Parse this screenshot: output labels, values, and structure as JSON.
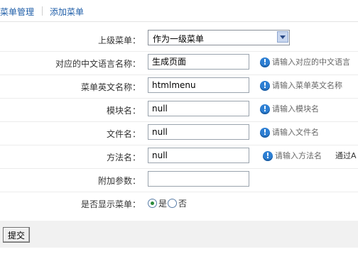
{
  "tabs": [
    {
      "label": "菜单管理"
    },
    {
      "label": "添加菜单"
    }
  ],
  "form": {
    "parent_menu": {
      "label": "上级菜单：",
      "selected": "作为一级菜单"
    },
    "cn_name": {
      "label": "对应的中文语言名称：",
      "value": "生成页面",
      "hint": "请输入对应的中文语言"
    },
    "en_name": {
      "label": "菜单英文名称：",
      "value": "htmlmenu",
      "hint": "请输入菜单英文名称"
    },
    "module": {
      "label": "模块名：",
      "value": "null",
      "hint": "请输入模块名"
    },
    "file": {
      "label": "文件名：",
      "value": "null",
      "hint": "请输入文件名"
    },
    "method": {
      "label": "方法名：",
      "value": "null",
      "hint": "请输入方法名",
      "extra": "通过A"
    },
    "params": {
      "label": "附加参数：",
      "value": ""
    },
    "show_menu": {
      "label": "是否显示菜单：",
      "options": [
        "是",
        "否"
      ],
      "selected": "是"
    }
  },
  "submit_label": "提交",
  "colors": {
    "link": "#1f5ea8",
    "info_icon": "#2d7fd3",
    "footer_bg": "#f1f1f1"
  }
}
